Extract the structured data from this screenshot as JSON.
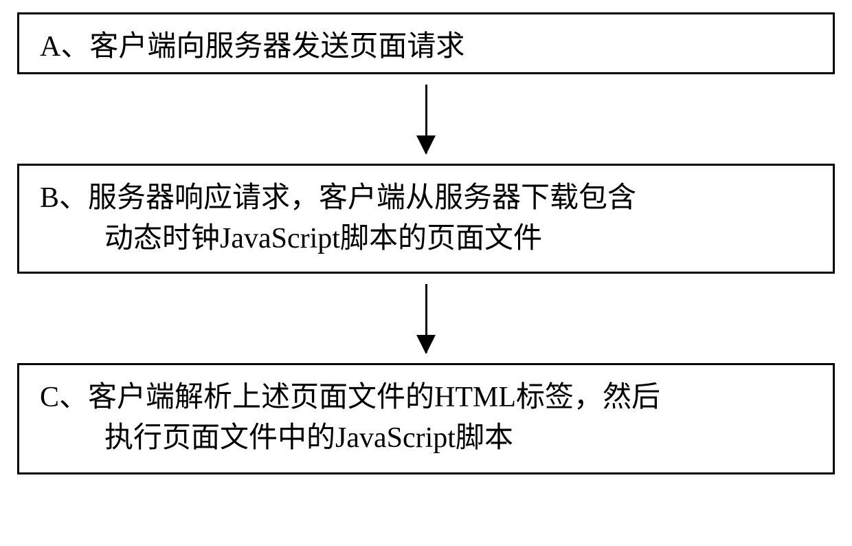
{
  "flowchart": {
    "steps": [
      {
        "label": "A、",
        "text": "客户端向服务器发送页面请求"
      },
      {
        "label": "B、",
        "line1": "服务器响应请求，客户端从服务器下载包含",
        "line2": "动态时钟JavaScript脚本的页面文件"
      },
      {
        "label": "C、",
        "line1": "客户端解析上述页面文件的HTML标签，然后",
        "line2": "执行页面文件中的JavaScript脚本"
      }
    ]
  }
}
